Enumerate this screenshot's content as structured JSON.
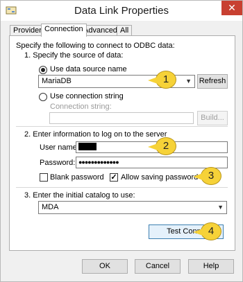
{
  "window": {
    "title": "Data Link Properties",
    "close_glyph": "✕"
  },
  "tabs": [
    "Provider",
    "Connection",
    "Advanced",
    "All"
  ],
  "connection": {
    "intro": "Specify the following to connect to ODBC data:",
    "step1": "1. Specify the source of data:",
    "use_dsn_label": "Use data source name",
    "dsn_value": "MariaDB",
    "refresh_label": "Refresh",
    "use_conn_string_label": "Use connection string",
    "conn_string_label": "Connection string:",
    "build_label": "Build...",
    "step2": "2. Enter information to log on to the server",
    "user_name_label": "User name:",
    "password_label": "Password:",
    "password_value": "●●●●●●●●●●●●●",
    "blank_password_label": "Blank password",
    "allow_saving_label": "Allow saving password",
    "step3": "3. Enter the initial catalog to use:",
    "catalog_value": "MDA",
    "test_connection_label": "Test Conne"
  },
  "buttons": {
    "ok": "OK",
    "cancel": "Cancel",
    "help": "Help"
  },
  "callouts": [
    "1",
    "2",
    "3",
    "4"
  ],
  "state": {
    "dsn_selected": true,
    "blank_password": false,
    "allow_saving": true
  },
  "colors": {
    "close_button": "#c84031",
    "callout_fill": "#f6d238"
  }
}
